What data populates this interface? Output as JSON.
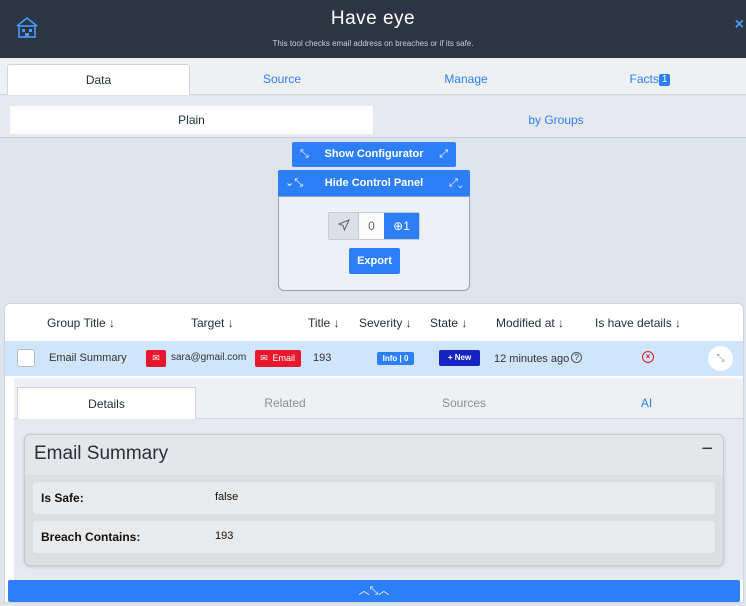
{
  "header": {
    "title": "Have eye",
    "subtitle": "This tool checks email address on breaches or if its safe.",
    "close_glyph": "×"
  },
  "main_tabs": [
    {
      "label": "Data",
      "active": true
    },
    {
      "label": "Source",
      "active": false
    },
    {
      "label": "Manage",
      "active": false
    },
    {
      "label": "Facts",
      "badge": "1",
      "active": false
    }
  ],
  "sub_tabs": [
    {
      "label": "Plain",
      "active": true
    },
    {
      "label": "by Groups",
      "active": false
    }
  ],
  "controls": {
    "show_configurator": "Show Configurator",
    "hide_control_panel": "Hide Control Panel",
    "stepper_value": "0",
    "stepper_add": "1",
    "export": "Export"
  },
  "table": {
    "columns": [
      "Group Title ↓",
      "Target ↓",
      "Title ↓",
      "Severity ↓",
      "State ↓",
      "Modified at ↓",
      "Is have details ↓"
    ],
    "row": {
      "group_title": "Email Summary",
      "target_email": "sara@gmail.com",
      "target_type": "Email",
      "title": "193",
      "severity": "Info | 0",
      "state": "+ New",
      "modified_at": "12 minutes ago",
      "help_glyph": "?"
    }
  },
  "detail_tabs": [
    {
      "label": "Details",
      "active": true
    },
    {
      "label": "Related",
      "active": false
    },
    {
      "label": "Sources",
      "active": false
    },
    {
      "label": "AI",
      "active": false
    }
  ],
  "card": {
    "title": "Email Summary",
    "minus": "−",
    "fields": [
      {
        "key": "Is Safe:",
        "value": "false"
      },
      {
        "key": "Breach Contains:",
        "value": "193"
      }
    ]
  },
  "icons": {
    "logo": "house-building-icon",
    "expand": "expand-arrows-icon",
    "collapse": "collapse-arrows-icon",
    "send": "send-icon",
    "add": "plus-circle-icon",
    "envelope": "envelope-icon",
    "help": "question-circle-icon",
    "error": "x-circle-icon"
  },
  "colors": {
    "accent": "#2d7ff9",
    "header_bg": "#2d3542",
    "danger": "#e8192c",
    "state_new": "#1724c2"
  }
}
